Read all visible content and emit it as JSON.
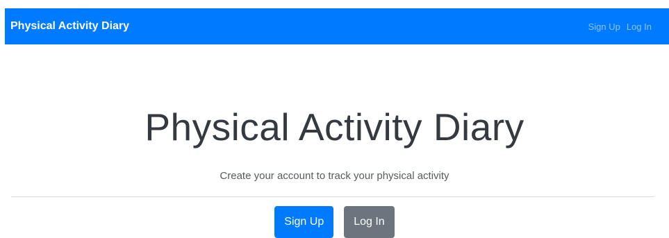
{
  "navbar": {
    "brand": "Physical Activity Diary",
    "links": [
      {
        "label": "Sign Up"
      },
      {
        "label": "Log In"
      }
    ]
  },
  "hero": {
    "title": "Physical Activity Diary",
    "lead": "Create your account to track your physical activity",
    "buttons": {
      "signup_label": "Sign Up",
      "login_label": "Log In"
    }
  },
  "colors": {
    "primary": "#007bff",
    "secondary": "#6c757d",
    "text_dark": "#343a40"
  }
}
